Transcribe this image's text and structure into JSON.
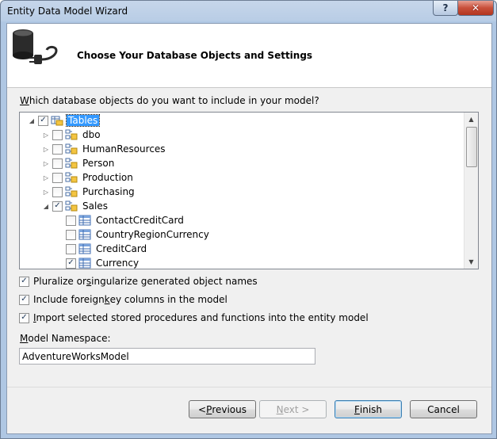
{
  "window": {
    "title": "Entity Data Model Wizard",
    "help_label": "?",
    "close_label": "✕"
  },
  "header": {
    "title": "Choose Your Database Objects and Settings",
    "icon": "database-plug-icon"
  },
  "question": {
    "accel": "W",
    "rest": "hich database objects do you want to include in your model?"
  },
  "tree": {
    "items": [
      {
        "label": "Tables",
        "level": 0,
        "expander": "expanded",
        "checked": "partial",
        "icon": "tables-folder-icon",
        "selected": true
      },
      {
        "label": "dbo",
        "level": 1,
        "expander": "collapsed",
        "checked": "none",
        "icon": "schema-icon"
      },
      {
        "label": "HumanResources",
        "level": 1,
        "expander": "collapsed",
        "checked": "none",
        "icon": "schema-icon"
      },
      {
        "label": "Person",
        "level": 1,
        "expander": "collapsed",
        "checked": "none",
        "icon": "schema-icon"
      },
      {
        "label": "Production",
        "level": 1,
        "expander": "collapsed",
        "checked": "none",
        "icon": "schema-icon"
      },
      {
        "label": "Purchasing",
        "level": 1,
        "expander": "collapsed",
        "checked": "none",
        "icon": "schema-icon"
      },
      {
        "label": "Sales",
        "level": 1,
        "expander": "expanded",
        "checked": "checked",
        "icon": "schema-icon"
      },
      {
        "label": "ContactCreditCard",
        "level": 2,
        "expander": "none",
        "checked": "none",
        "icon": "table-icon"
      },
      {
        "label": "CountryRegionCurrency",
        "level": 2,
        "expander": "none",
        "checked": "none",
        "icon": "table-icon"
      },
      {
        "label": "CreditCard",
        "level": 2,
        "expander": "none",
        "checked": "none",
        "icon": "table-icon"
      },
      {
        "label": "Currency",
        "level": 2,
        "expander": "none",
        "checked": "checked",
        "icon": "table-icon"
      }
    ]
  },
  "options": [
    {
      "pre": "Pluralize or ",
      "accel": "s",
      "post": "ingularize generated object names",
      "checked": true
    },
    {
      "pre": "Include foreign ",
      "accel": "k",
      "post": "ey columns in the model",
      "checked": true
    },
    {
      "pre": "",
      "accel": "I",
      "post": "mport selected stored procedures and functions into the entity model",
      "checked": true
    }
  ],
  "namespace": {
    "label_accel": "M",
    "label_rest": "odel Namespace:",
    "value": "AdventureWorksModel"
  },
  "buttons": {
    "previous": {
      "pre": "< ",
      "accel": "P",
      "post": "revious",
      "enabled": true
    },
    "next": {
      "pre": "",
      "accel": "N",
      "post": "ext >",
      "enabled": false
    },
    "finish": {
      "pre": "",
      "accel": "F",
      "post": "inish",
      "enabled": true
    },
    "cancel": {
      "label": "Cancel",
      "enabled": true
    }
  }
}
